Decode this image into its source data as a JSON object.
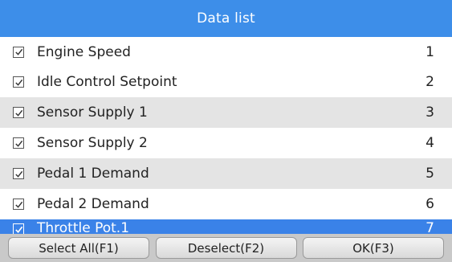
{
  "header": {
    "title": "Data list"
  },
  "list": {
    "items": [
      {
        "label": "Engine Speed",
        "number": "1",
        "checked": true
      },
      {
        "label": "Idle Control Setpoint",
        "number": "2",
        "checked": true
      },
      {
        "label": "Sensor Supply 1",
        "number": "3",
        "checked": true
      },
      {
        "label": "Sensor Supply 2",
        "number": "4",
        "checked": true
      },
      {
        "label": "Pedal 1 Demand",
        "number": "5",
        "checked": true
      },
      {
        "label": "Pedal 2 Demand",
        "number": "6",
        "checked": true
      },
      {
        "label": "Throttle Pot.1",
        "number": "7",
        "checked": true
      }
    ]
  },
  "footer": {
    "select_all_label": "Select All(F1)",
    "deselect_label": "Deselect(F2)",
    "ok_label": "OK(F3)"
  },
  "colors": {
    "title_bar": "#3d8ee9",
    "selected_row": "#3a82e8",
    "alt_row": "#e4e4e4",
    "bottom_bar": "#c9c9c9"
  }
}
